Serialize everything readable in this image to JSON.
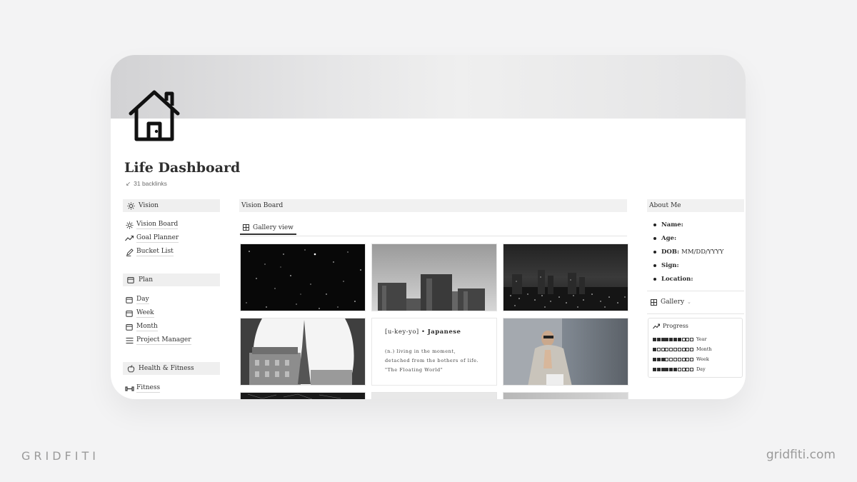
{
  "page": {
    "title": "Life Dashboard",
    "backlinks": "31 backlinks",
    "icon": "house-icon"
  },
  "sidebar": {
    "sections": [
      {
        "title": "Vision",
        "icon": "sun-icon",
        "items": [
          {
            "label": "Vision Board",
            "icon": "sun-icon"
          },
          {
            "label": "Goal Planner",
            "icon": "trend-icon"
          },
          {
            "label": "Bucket List",
            "icon": "pen-icon"
          }
        ]
      },
      {
        "title": "Plan",
        "icon": "calendar-icon",
        "items": [
          {
            "label": "Day",
            "icon": "calendar-icon"
          },
          {
            "label": "Week",
            "icon": "calendar-icon"
          },
          {
            "label": "Month",
            "icon": "calendar-icon"
          },
          {
            "label": "Project Manager",
            "icon": "list-icon"
          }
        ]
      },
      {
        "title": "Health & Fitness",
        "icon": "apple-icon",
        "items": [
          {
            "label": "Fitness",
            "icon": "dumbbell-icon"
          }
        ]
      }
    ]
  },
  "main": {
    "header": "Vision Board",
    "view_tab": "Gallery view",
    "cards": [
      {
        "kind": "stars"
      },
      {
        "kind": "buildings"
      },
      {
        "kind": "city-night"
      },
      {
        "kind": "paris"
      },
      {
        "kind": "quote",
        "word": "[u-key-yo]",
        "lang": "Japanese",
        "line1": "(n.) living in the moment,",
        "line2": "detached from the bothers of life.",
        "line3": "\"The Floating World\""
      },
      {
        "kind": "person"
      },
      {
        "kind": "dark"
      },
      {
        "kind": "light"
      },
      {
        "kind": "grey"
      }
    ]
  },
  "about": {
    "header": "About Me",
    "fields": [
      {
        "label": "Name:",
        "value": ""
      },
      {
        "label": "Age:",
        "value": ""
      },
      {
        "label": "DOB:",
        "value": "MM/DD/YYYY"
      },
      {
        "label": "Sign:",
        "value": ""
      },
      {
        "label": "Location:",
        "value": ""
      }
    ],
    "gallery_label": "Gallery",
    "progress": {
      "title": "Progress",
      "rows": [
        {
          "label": "Year",
          "filled": 7,
          "total": 10
        },
        {
          "label": "Month",
          "filled": 1,
          "total": 10
        },
        {
          "label": "Week",
          "filled": 3,
          "total": 10
        },
        {
          "label": "Day",
          "filled": 6,
          "total": 10
        }
      ]
    }
  },
  "branding": {
    "left": "GRIDFITI",
    "right": "gridfiti.com"
  },
  "colors": {
    "background": "#f3f3f4",
    "section_header": "#efefef",
    "text": "#2b2b2b"
  }
}
